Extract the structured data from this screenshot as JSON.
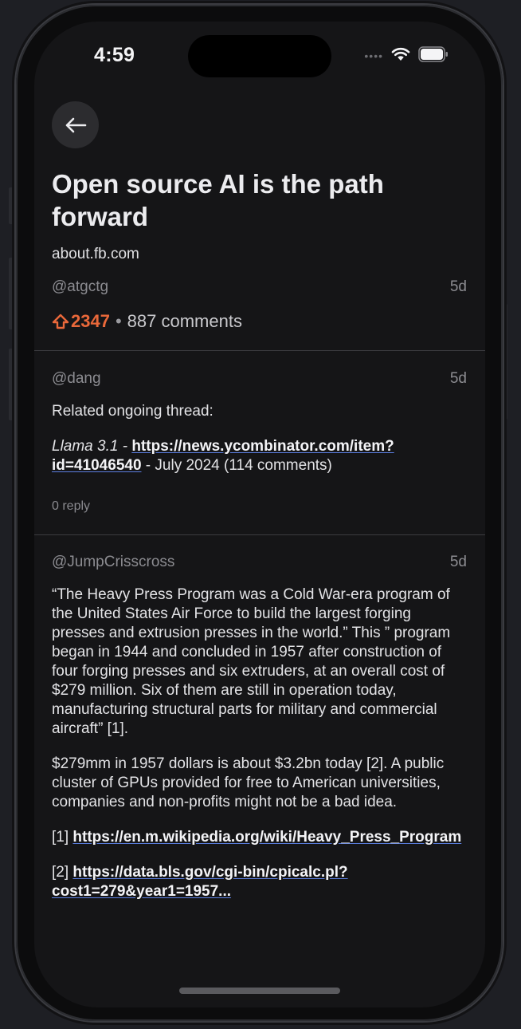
{
  "status_bar": {
    "time": "4:59"
  },
  "story": {
    "title": "Open source AI is the path forward",
    "domain": "about.fb.com",
    "author": "@atgctg",
    "age": "5d",
    "score": "2347",
    "separator": "•",
    "comments": "887 comments"
  },
  "comments": [
    {
      "author": "@dang",
      "age": "5d",
      "intro": "Related ongoing thread:",
      "link_prefix": "Llama 3.1 - ",
      "link_text": "https://news.ycombinator.com/item?id=41046540",
      "link_suffix": " - July 2024 (114 comments)",
      "reply": "0 reply"
    },
    {
      "author": "@JumpCrisscross",
      "age": "5d",
      "paragraph1": "“The Heavy Press Program was a Cold War-era program of the United States Air Force to build the largest forging presses and extrusion presses in the world.” This ” program began in 1944 and concluded in 1957 after construction of four forging presses and six extruders, at an overall cost of $279 million. Six of them are still in operation today, manufacturing structural parts for military and commercial aircraft” [1].",
      "paragraph2": "$279mm in 1957 dollars is about $3.2bn today [2]. A public cluster of GPUs provided for free to American universities, companies and non-profits might not be a bad idea.",
      "ref1_label": "[1] ",
      "ref1_link": "https://en.m.wikipedia.org/wiki/Heavy_Press_Program",
      "ref2_label": "[2] ",
      "ref2_link": "https://data.bls.gov/cgi-bin/cpicalc.pl?cost1=279&year1=1957..."
    }
  ],
  "colors": {
    "accent": "#e9683a",
    "background": "#151517",
    "link_underline": "#5b7ee0"
  }
}
